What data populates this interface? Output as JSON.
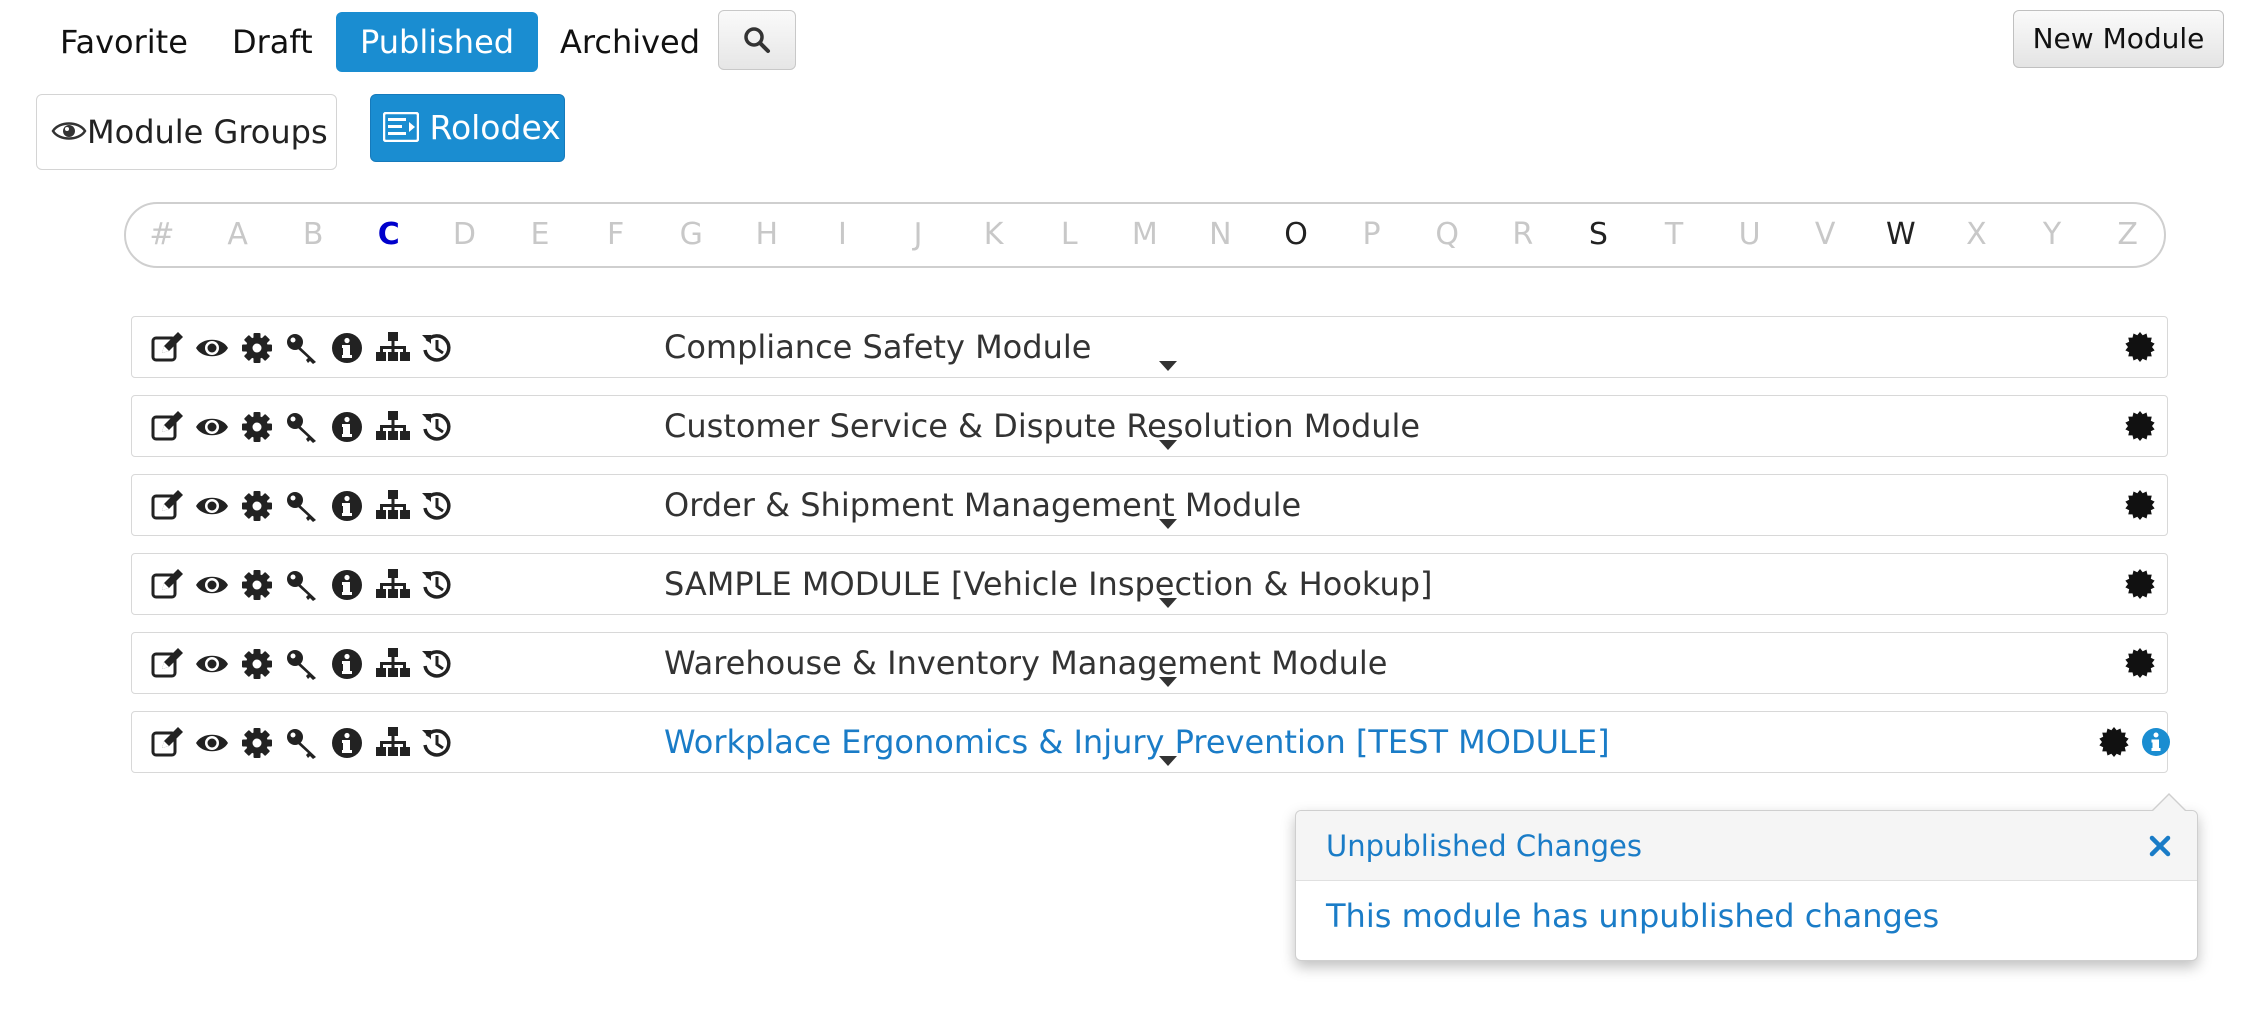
{
  "status_tabs": [
    {
      "label": "Favorite",
      "active": false
    },
    {
      "label": "Draft",
      "active": false
    },
    {
      "label": "Published",
      "active": true
    },
    {
      "label": "Archived",
      "active": false
    }
  ],
  "toolbar": {
    "search_icon": "search-icon",
    "new_module_label": "New Module"
  },
  "view_toggles": {
    "module_groups_label": "Module Groups",
    "module_groups_icon": "eye-icon",
    "rolodex_label": "Rolodex",
    "rolodex_icon": "rolodex-icon"
  },
  "alphabet": {
    "letters": [
      "#",
      "A",
      "B",
      "C",
      "D",
      "E",
      "F",
      "G",
      "H",
      "I",
      "J",
      "K",
      "L",
      "M",
      "N",
      "O",
      "P",
      "Q",
      "R",
      "S",
      "T",
      "U",
      "V",
      "W",
      "X",
      "Y",
      "Z"
    ],
    "current": "C",
    "available": [
      "C",
      "O",
      "S",
      "W"
    ]
  },
  "row_actions": [
    "edit-icon",
    "view-icon",
    "settings-icon",
    "key-icon",
    "info-icon",
    "hierarchy-icon",
    "history-icon"
  ],
  "modules": [
    {
      "title": "Compliance Safety Module",
      "highlighted": false,
      "has_info": false
    },
    {
      "title": "Customer Service & Dispute Resolution Module",
      "highlighted": false,
      "has_info": false
    },
    {
      "title": "Order & Shipment Management Module",
      "highlighted": false,
      "has_info": false
    },
    {
      "title": "SAMPLE MODULE [Vehicle Inspection & Hookup]",
      "highlighted": false,
      "has_info": false
    },
    {
      "title": "Warehouse & Inventory Management Module",
      "highlighted": false,
      "has_info": false
    },
    {
      "title": "Workplace Ergonomics & Injury Prevention [TEST MODULE]",
      "highlighted": true,
      "has_info": true
    }
  ],
  "popover": {
    "title": "Unpublished Changes",
    "body": "This module has unpublished changes"
  },
  "colors": {
    "accent": "#1a8dd1",
    "link": "#1a7cc7",
    "current_letter": "#0000cc",
    "disabled_letter": "#c8c8c8"
  }
}
